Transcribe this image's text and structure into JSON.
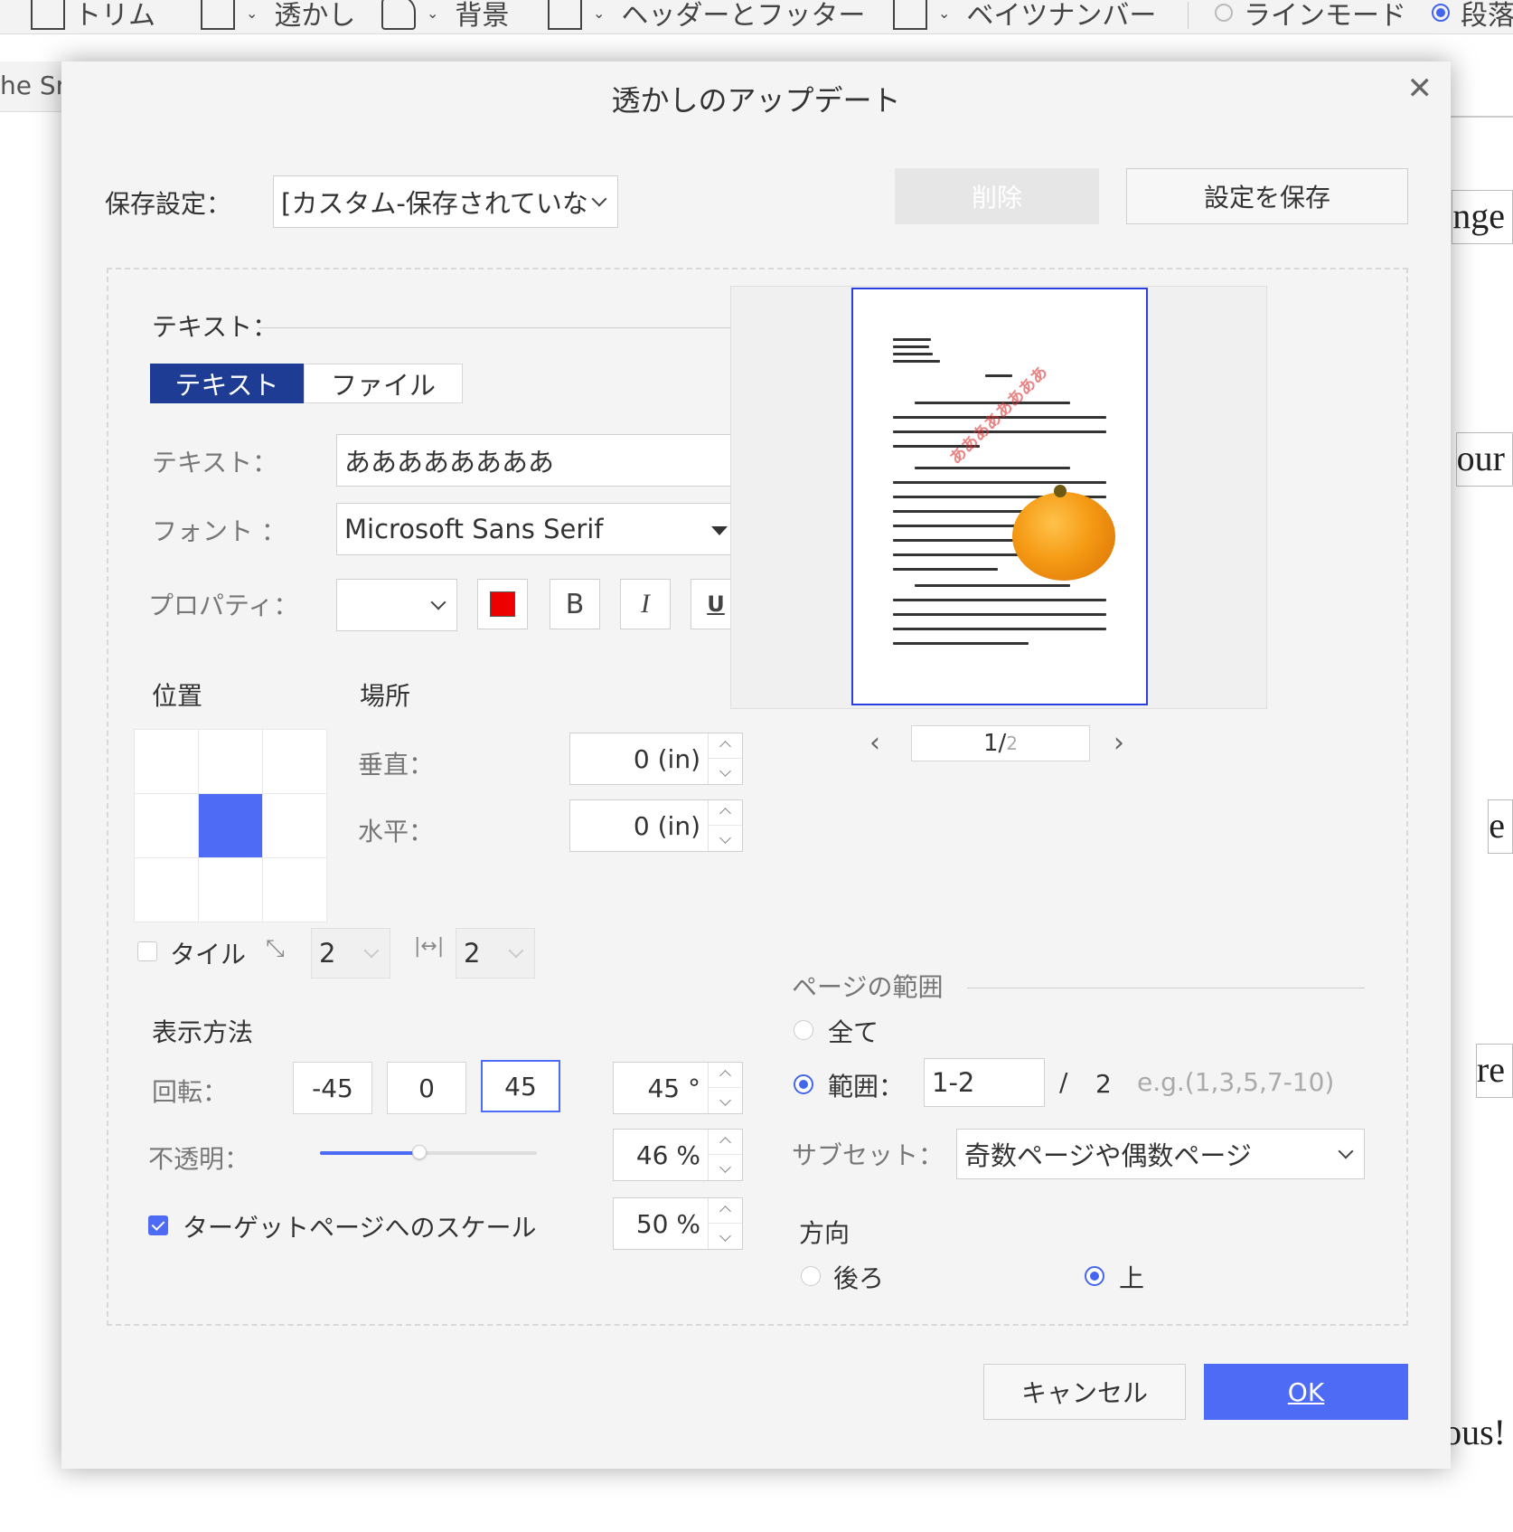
{
  "toolbar": {
    "items": [
      {
        "label": "トリム",
        "icon": "trim-icon"
      },
      {
        "label": "透かし",
        "icon": "watermark-icon"
      },
      {
        "label": "背景",
        "icon": "background-icon"
      },
      {
        "label": "ヘッダーとフッター",
        "icon": "header-footer-icon"
      },
      {
        "label": "ベイツナンバー",
        "icon": "bates-number-icon"
      }
    ],
    "line_mode": "ラインモード",
    "paragraph_mode": "段落"
  },
  "background_doc": {
    "tab_fragment": "he Sn",
    "words": [
      "nge",
      "our",
      "e",
      "re",
      "ous!"
    ]
  },
  "dialog": {
    "title": "透かしのアップデート",
    "save_settings_label": "保存設定：",
    "save_settings_value": "[カスタム-保存されていな",
    "delete_label": "削除",
    "save_button_label": "設定を保存",
    "text_section": {
      "title": "テキスト：",
      "tabs": [
        "テキスト",
        "ファイル"
      ],
      "text_label": "テキスト：",
      "text_value": "ああああああああ",
      "font_label": "フォント ：",
      "font_value": "Microsoft Sans Serif",
      "properties_label": "プロパティ：",
      "font_size_value": "",
      "color": "#ee0000",
      "bold_label": "B",
      "italic_label": "I",
      "underline_label": "U"
    },
    "position_section": {
      "position_label": "位置",
      "location_label": "場所",
      "vertical_label": "垂直：",
      "vertical_value": "0 (in)",
      "horizontal_label": "水平：",
      "horizontal_value": "0 (in)",
      "selected_cell": 4,
      "tile_label": "タイル",
      "tile_rows": "2",
      "tile_cols": "2"
    },
    "display_section": {
      "title": "表示方法",
      "rotation_label": "回転：",
      "rotation_options": [
        "-45",
        "0",
        "45"
      ],
      "rotation_selected": "45",
      "rotation_value": "45 °",
      "opacity_label": "不透明：",
      "opacity_percent": 46,
      "opacity_value": "46 %",
      "scale_label": "ターゲットページへのスケール",
      "scale_checked": true,
      "scale_value": "50 %"
    },
    "preview": {
      "current_page": "1",
      "total_pages": "2",
      "separator": "/"
    },
    "page_range": {
      "title": "ページの範囲",
      "all_label": "全て",
      "range_label": "範囲：",
      "range_value": "1-2",
      "range_separator": "/",
      "range_total": "2",
      "range_hint": "e.g.(1,3,5,7-10)",
      "subset_label": "サブセット：",
      "subset_value": "奇数ページや偶数ページ"
    },
    "direction": {
      "title": "方向",
      "back_label": "後ろ",
      "front_label": "上"
    },
    "cancel_label": "キャンセル",
    "ok_label": "OK"
  },
  "accent_color": "#4e6bf5"
}
